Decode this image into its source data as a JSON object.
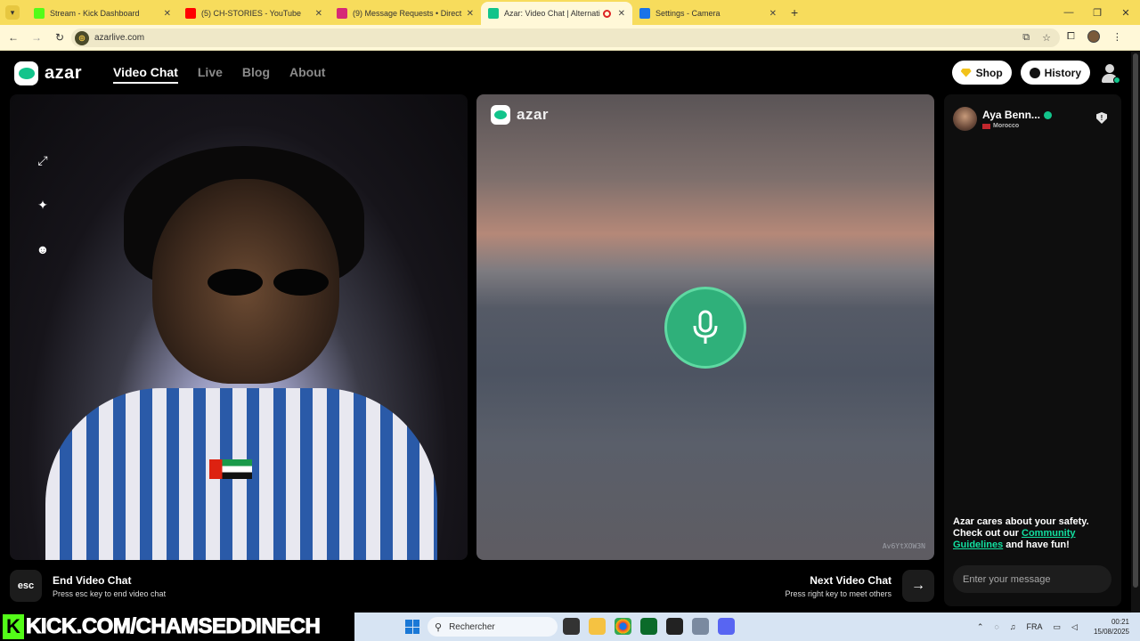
{
  "browser": {
    "tabs": [
      {
        "label": "Stream - Kick Dashboard",
        "favicon_color": "#53fc18",
        "active": false
      },
      {
        "label": "(5) CH-STORIES - YouTube",
        "favicon_color": "#ff0000",
        "active": false
      },
      {
        "label": "(9) Message Requests • Direct",
        "favicon_color": "#d62976",
        "active": false
      },
      {
        "label": "Azar: Video Chat | Alternati",
        "favicon_color": "#12c48b",
        "active": true
      },
      {
        "label": "Settings - Camera",
        "favicon_color": "#1a73e8",
        "active": false
      }
    ],
    "url": "azarlive.com"
  },
  "site": {
    "logo": "azar",
    "nav": [
      {
        "label": "Video Chat",
        "active": true
      },
      {
        "label": "Live",
        "active": false
      },
      {
        "label": "Blog",
        "active": false
      },
      {
        "label": "About",
        "active": false
      }
    ],
    "shop_label": "Shop",
    "history_label": "History"
  },
  "remote_video": {
    "logo": "azar",
    "session_id": "Av6YtXOW3N"
  },
  "chat": {
    "partner_name": "Aya Benn...",
    "partner_country": "Morocco",
    "safety_prefix": "Azar cares about your safety. Check out our ",
    "safety_link": "Community Guidelines",
    "safety_suffix": " and have fun!",
    "input_placeholder": "Enter your message"
  },
  "footer": {
    "esc_key": "esc",
    "end_title": "End Video Chat",
    "end_sub": "Press esc key to end video chat",
    "next_title": "Next Video Chat",
    "next_sub": "Press right key to meet others"
  },
  "overlay": {
    "kick_text": "KICK.COM/CHAMSEDDINECH"
  },
  "taskbar": {
    "search_placeholder": "Rechercher",
    "language": "FRA",
    "time": "00:21",
    "date": "15/08/2025"
  },
  "colors": {
    "accent": "#12c48b",
    "tab_bar": "#f7dc5c"
  }
}
